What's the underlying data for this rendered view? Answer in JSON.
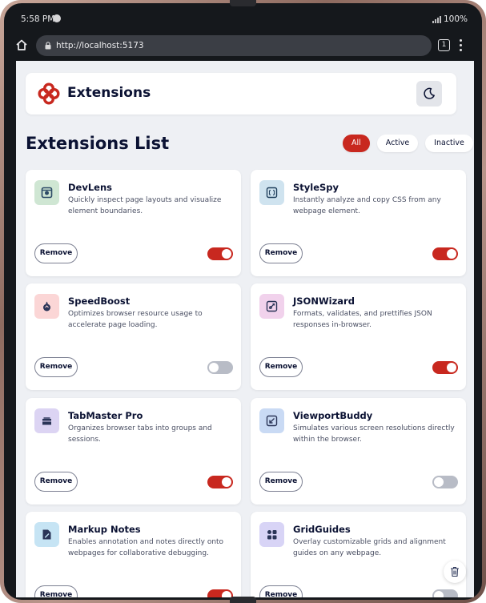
{
  "status": {
    "time": "5:58 PM",
    "battery": "100%"
  },
  "browser": {
    "url": "http://localhost:5173",
    "tab_count": "1"
  },
  "app": {
    "title": "Extensions"
  },
  "list": {
    "title": "Extensions List",
    "filters": [
      {
        "label": "All",
        "active": true
      },
      {
        "label": "Active",
        "active": false
      },
      {
        "label": "Inactive",
        "active": false
      }
    ]
  },
  "remove_label": "Remove",
  "extensions": [
    {
      "name": "DevLens",
      "description": "Quickly inspect page layouts and visualize element boundaries.",
      "enabled": true,
      "icon": "devlens-icon",
      "icon_bg": "#cfe6d3",
      "icon_fg": "#2c4a66"
    },
    {
      "name": "StyleSpy",
      "description": "Instantly analyze and copy CSS from any webpage element.",
      "enabled": true,
      "icon": "stylespy-icon",
      "icon_bg": "#cfe3ef",
      "icon_fg": "#1f3f5c"
    },
    {
      "name": "SpeedBoost",
      "description": "Optimizes browser resource usage to accelerate page loading.",
      "enabled": false,
      "icon": "speedboost-icon",
      "icon_bg": "#fbd6d6",
      "icon_fg": "#2b3558"
    },
    {
      "name": "JSONWizard",
      "description": "Formats, validates, and prettifies JSON responses in-browser.",
      "enabled": true,
      "icon": "jsonwizard-icon",
      "icon_bg": "#f1d2ec",
      "icon_fg": "#2b3558"
    },
    {
      "name": "TabMaster Pro",
      "description": "Organizes browser tabs into groups and sessions.",
      "enabled": true,
      "icon": "tabmaster-icon",
      "icon_bg": "#dcd4f3",
      "icon_fg": "#2b3558"
    },
    {
      "name": "ViewportBuddy",
      "description": "Simulates various screen resolutions directly within the browser.",
      "enabled": false,
      "icon": "viewport-icon",
      "icon_bg": "#c9daf4",
      "icon_fg": "#2b3558"
    },
    {
      "name": "Markup Notes",
      "description": "Enables annotation and notes directly onto webpages for collaborative debugging.",
      "enabled": true,
      "icon": "markup-notes-icon",
      "icon_bg": "#c6e4f4",
      "icon_fg": "#2b3558"
    },
    {
      "name": "GridGuides",
      "description": "Overlay customizable grids and alignment guides on any webpage.",
      "enabled": false,
      "icon": "gridguides-icon",
      "icon_bg": "#d8d4f6",
      "icon_fg": "#2b3558"
    }
  ],
  "colors": {
    "accent": "#c8281f",
    "background": "#eef0f4",
    "text": "#0b1233"
  }
}
